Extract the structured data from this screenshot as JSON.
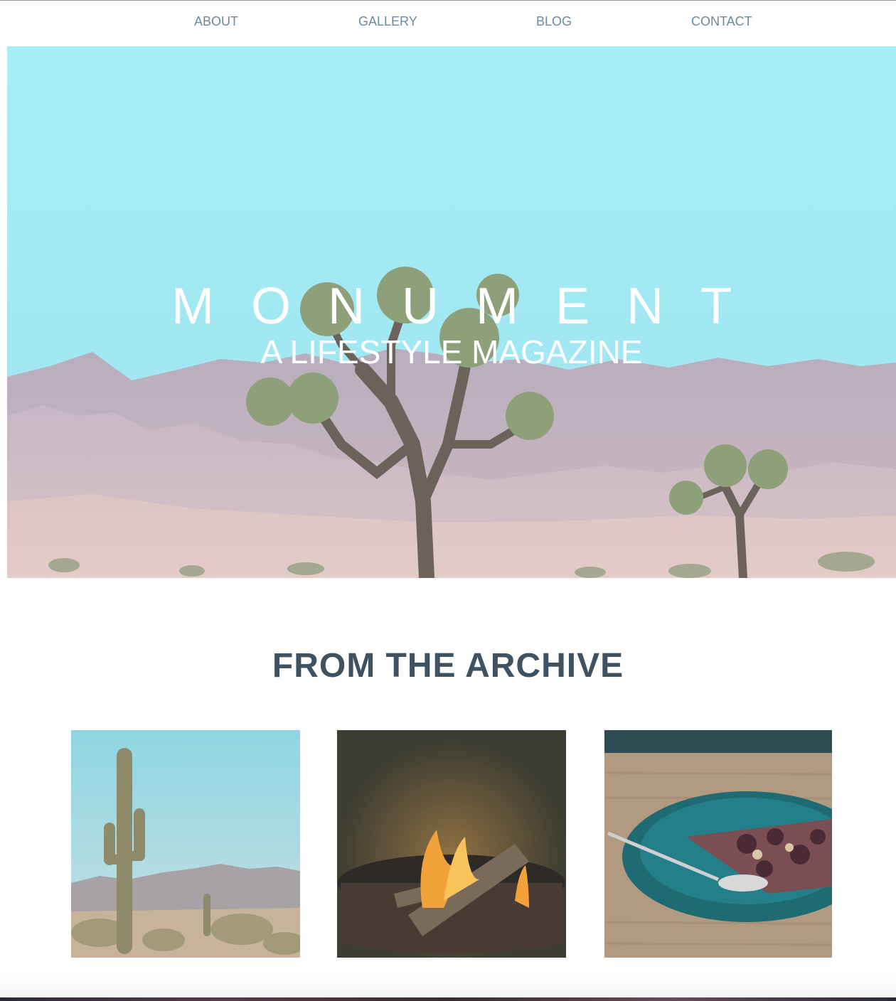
{
  "nav": {
    "items": [
      {
        "label": "ABOUT"
      },
      {
        "label": "GALLERY"
      },
      {
        "label": "BLOG"
      },
      {
        "label": "CONTACT"
      }
    ]
  },
  "hero": {
    "title": "MONUMENT",
    "subtitle": "A LIFESTYLE MAGAZINE"
  },
  "archive": {
    "title": "FROM THE ARCHIVE",
    "tiles": [
      {
        "image": "saguaro-cactus-desert"
      },
      {
        "image": "campfire-fire-pit"
      },
      {
        "image": "plate-of-tart-with-spoon"
      }
    ]
  },
  "colors": {
    "nav_text": "#6a8aa2",
    "heading": "#3e5262",
    "sky": "#9feaf4"
  }
}
